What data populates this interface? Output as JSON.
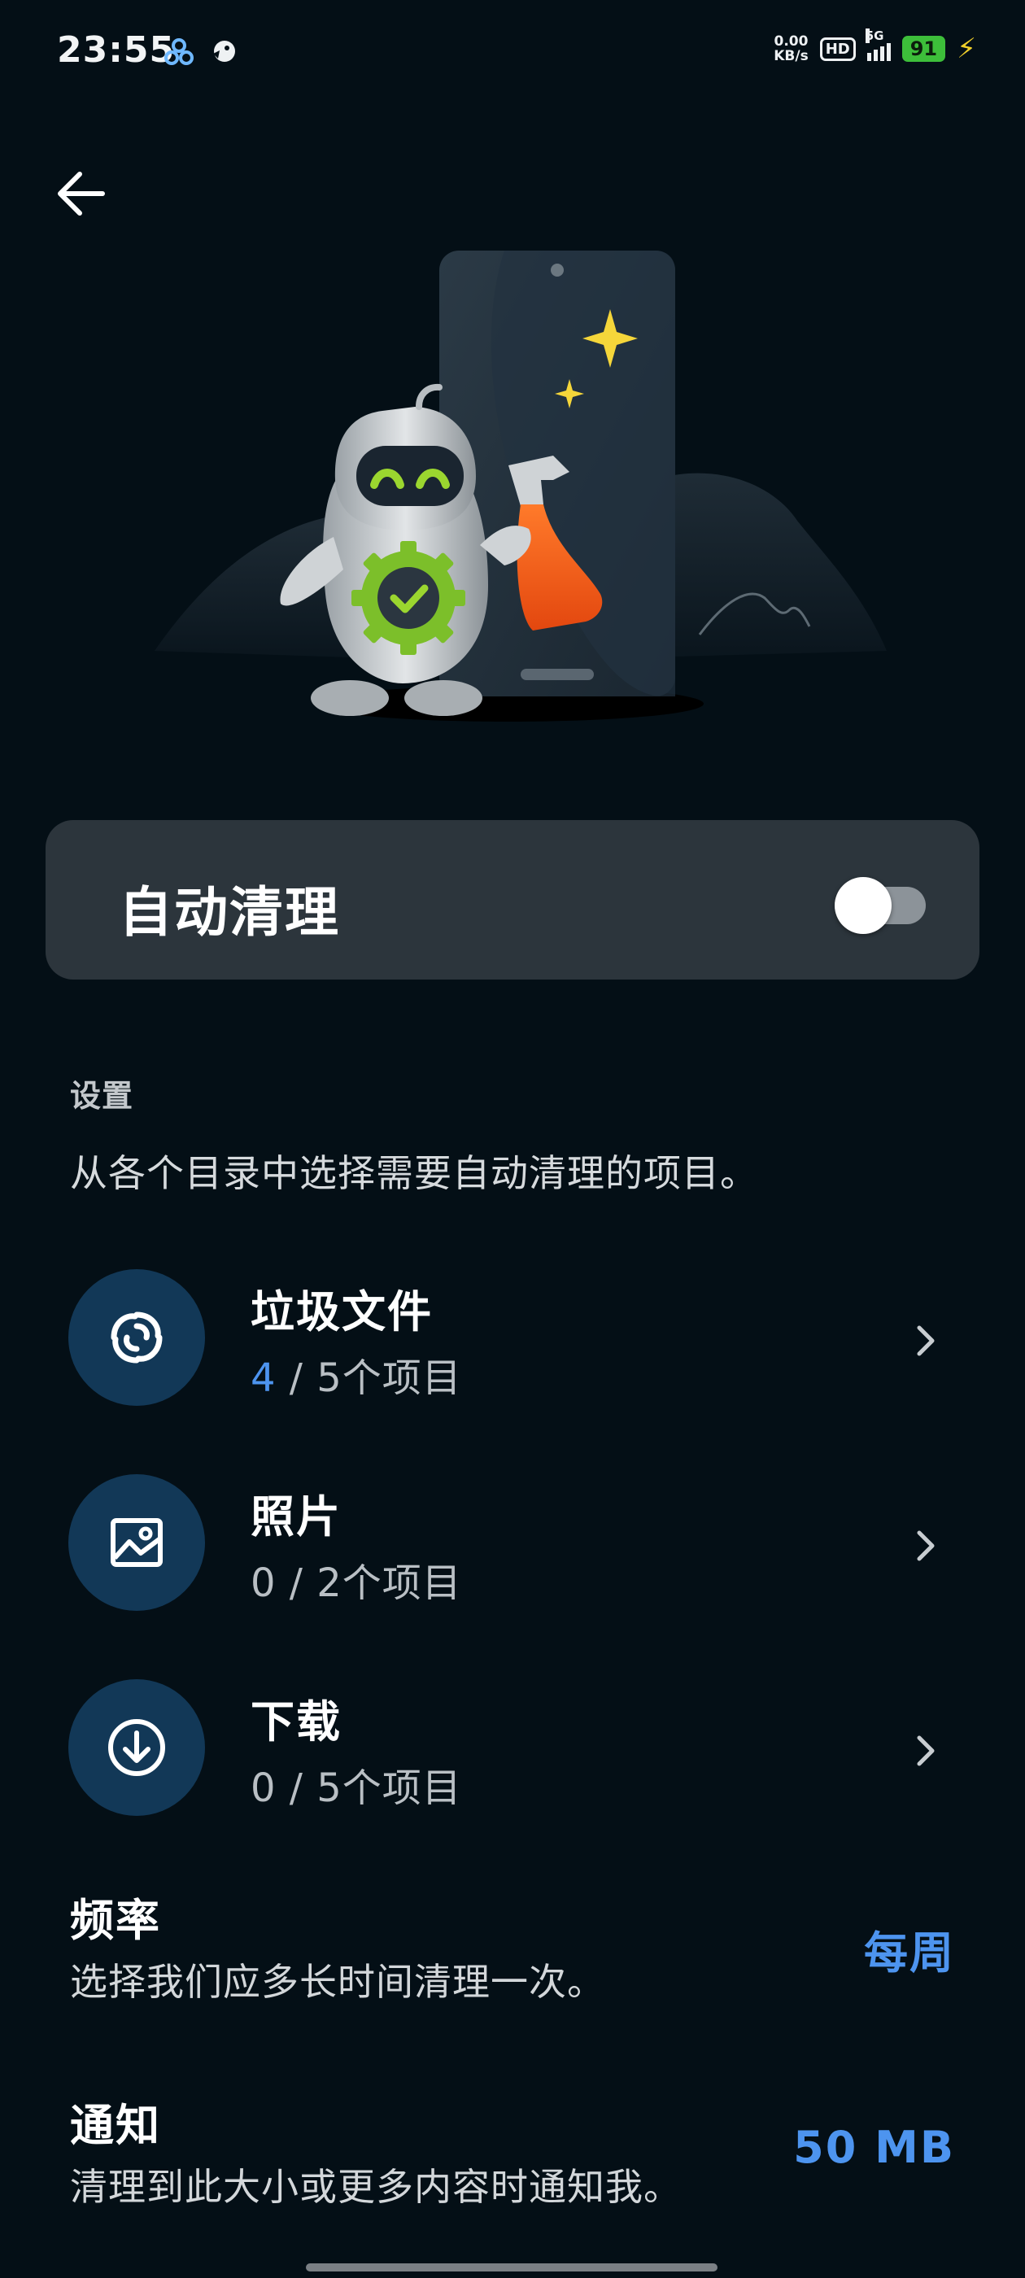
{
  "status_bar": {
    "time": "23:55",
    "net_speed_value": "0.00",
    "net_speed_unit": "KB/s",
    "hd_label": "HD",
    "signal_label": "5G",
    "battery": "91"
  },
  "header": {
    "back_icon": "arrow-left-icon"
  },
  "hero": {
    "illustration": "robot-cleaning-phone"
  },
  "auto_clean": {
    "label": "自动清理",
    "enabled": false
  },
  "settings": {
    "heading": "设置",
    "description": "从各个目录中选择需要自动清理的项目。"
  },
  "categories": [
    {
      "icon": "junk-swirl-icon",
      "title": "垃圾文件",
      "selected": "4",
      "sep": " / ",
      "total": "5个项目"
    },
    {
      "icon": "photo-icon",
      "title": "照片",
      "selected": "0",
      "sep": " / ",
      "total": "2个项目"
    },
    {
      "icon": "download-icon",
      "title": "下载",
      "selected": "0",
      "sep": " / ",
      "total": "5个项目"
    }
  ],
  "frequency": {
    "title": "频率",
    "description": "选择我们应多长时间清理一次。",
    "value": "每周"
  },
  "notification": {
    "title": "通知",
    "description": "清理到此大小或更多内容时通知我。",
    "value": "50 MB"
  },
  "colors": {
    "background": "#040f16",
    "card": "#2c353c",
    "accent": "#4d94ef",
    "icon_circle": "#123857"
  }
}
